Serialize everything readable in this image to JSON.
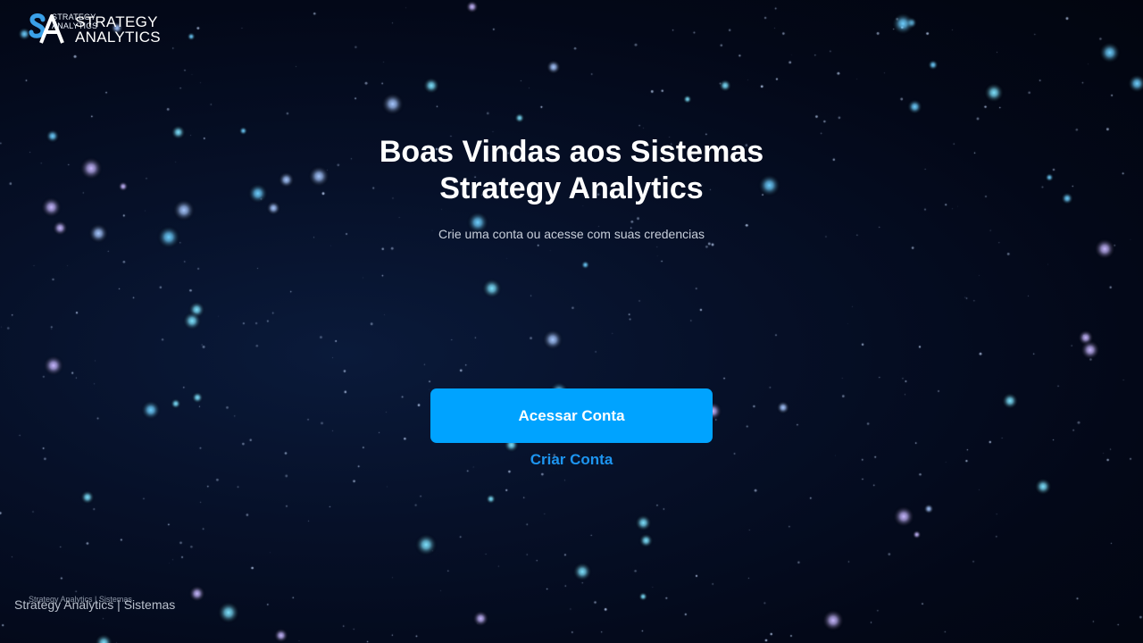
{
  "brand": {
    "logo_small_line1": "STRATEGY",
    "logo_small_line2": "ANALYTICS",
    "logo_big_line1": "STRATEGY",
    "logo_big_line2": "ANALYTICS",
    "logo_icon": "sa-monogram-icon"
  },
  "hero": {
    "title_line1": "Boas Vindas aos Sistemas",
    "title_line2": "Strategy Analytics",
    "subtitle": "Crie uma conta ou acesse com suas credencias"
  },
  "actions": {
    "login_label": "Acessar Conta",
    "signup_label": "Criar Conta"
  },
  "footer": {
    "small_text": "Strategy Analytics | Sistemas",
    "text": "Strategy Analytics | Sistemas"
  },
  "colors": {
    "background": "#030818",
    "accent": "#00a3ff",
    "link": "#1d95f0",
    "star": "#7fd8ff"
  }
}
